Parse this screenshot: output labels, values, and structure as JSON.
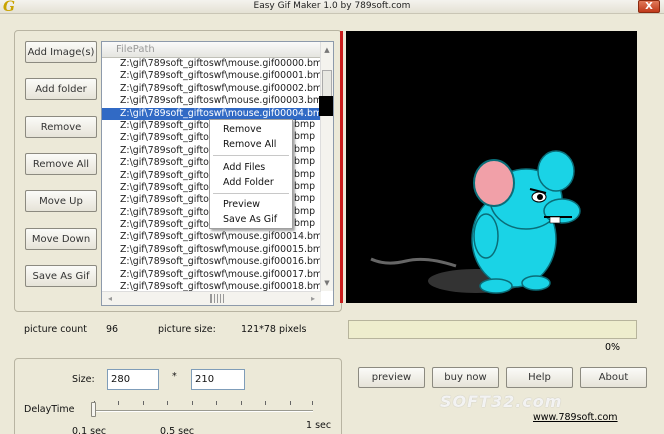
{
  "window": {
    "title": "Easy Gif Maker 1.0 by 789soft.com",
    "app_icon_letter": "G",
    "close_label": "X"
  },
  "left_buttons": {
    "add_images": "Add Image(s)",
    "add_folder": "Add folder",
    "remove": "Remove",
    "remove_all": "Remove All",
    "move_up": "Move Up",
    "move_down": "Move Down",
    "save_as_gif": "Save As Gif"
  },
  "file_list": {
    "header": "FilePath",
    "selected_index": 4,
    "rows": [
      "Z:\\gif\\789soft_giftoswf\\mouse.gif00000.bmp",
      "Z:\\gif\\789soft_giftoswf\\mouse.gif00001.bmp",
      "Z:\\gif\\789soft_giftoswf\\mouse.gif00002.bmp",
      "Z:\\gif\\789soft_giftoswf\\mouse.gif00003.bmp",
      "Z:\\gif\\789soft_giftoswf\\mouse.gif00004.bmp",
      "Z:\\gif\\789soft_giftos",
      "Z:\\gif\\789soft_giftos",
      "Z:\\gif\\789soft_giftos",
      "Z:\\gif\\789soft_giftos",
      "Z:\\gif\\789soft_giftos",
      "Z:\\gif\\789soft_giftos",
      "Z:\\gif\\789soft_giftos",
      "Z:\\gif\\789soft_giftos",
      "Z:\\gif\\789soft_giftos",
      "Z:\\gif\\789soft_giftoswf\\mouse.gif00014.bmp",
      "Z:\\gif\\789soft_giftoswf\\mouse.gif00015.bmp",
      "Z:\\gif\\789soft_giftoswf\\mouse.gif00016.bmp",
      "Z:\\gif\\789soft_giftoswf\\mouse.gif00017.bmp",
      "Z:\\gif\\789soft_giftoswf\\mouse.gif00018.bmp"
    ],
    "row_suffixes": [
      "bmp",
      "bmp",
      "bmp",
      "bmp",
      "bmp",
      "bmp",
      "bmp",
      "bmp",
      "bmp"
    ]
  },
  "context_menu": {
    "remove": "Remove",
    "remove_all": "Remove All",
    "add_files": "Add Files",
    "add_folder": "Add Folder",
    "preview": "Preview",
    "save_as_gif": "Save As Gif"
  },
  "info": {
    "picture_count_label": "picture count",
    "picture_count_value": "96",
    "picture_size_label": "picture size:",
    "picture_size_value": "121*78 pixels"
  },
  "progress": {
    "fraction": 0,
    "text": "0%"
  },
  "settings": {
    "size_label": "Size:",
    "width_value": "280",
    "separator": "*",
    "height_value": "210",
    "delay_label": "DelayTime",
    "delay_min": "0.1 sec",
    "delay_mid": "0.5 sec",
    "delay_max": "1 sec"
  },
  "right_buttons": {
    "preview": "preview",
    "buy_now": "buy now",
    "help": "Help",
    "about": "About"
  },
  "footer": {
    "watermark": "SOFT32.com",
    "website": "www.789soft.com"
  },
  "colors": {
    "selection": "#316ac5",
    "preview_bg": "#000000",
    "mouse_body": "#1ad3e6",
    "mouse_ear": "#f1a0a8"
  }
}
